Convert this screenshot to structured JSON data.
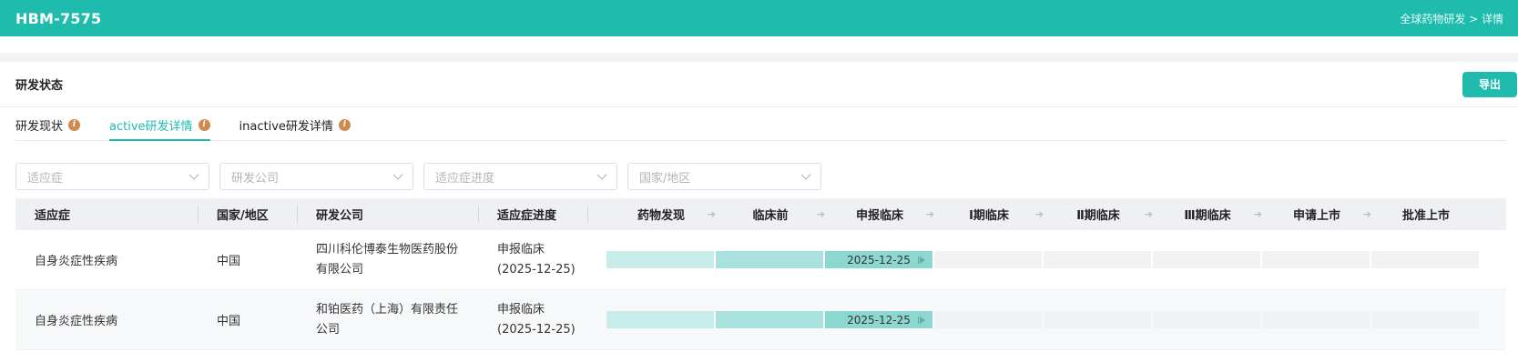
{
  "header": {
    "title": "HBM-7575",
    "breadcrumb": "全球药物研发 > 详情"
  },
  "card": {
    "title": "研发状态",
    "export_label": "导出"
  },
  "tabs": [
    {
      "label": "研发现状"
    },
    {
      "label": "active研发详情"
    },
    {
      "label": "inactive研发详情"
    }
  ],
  "filters": {
    "indication": "适应症",
    "company": "研发公司",
    "progress": "适应症进度",
    "region": "国家/地区"
  },
  "table": {
    "headers": {
      "indication": "适应症",
      "region": "国家/地区",
      "company": "研发公司",
      "progress": "适应症进度"
    },
    "stages": [
      "药物发现",
      "临床前",
      "申报临床",
      "Ⅰ期临床",
      "Ⅱ期临床",
      "Ⅲ期临床",
      "申请上市",
      "批准上市"
    ],
    "rows": [
      {
        "indication": "自身炎症性疾病",
        "region": "中国",
        "company_line1": "四川科伦博泰生物医药股份",
        "company_line2": "有限公司",
        "progress_line1": "申报临床",
        "progress_line2": "(2025-12-25)",
        "stage_date": "2025-12-25"
      },
      {
        "indication": "自身炎症性疾病",
        "region": "中国",
        "company_line1": "和铂医药（上海）有限责任",
        "company_line2": "公司",
        "progress_line1": "申报临床",
        "progress_line2": "(2025-12-25)",
        "stage_date": "2025-12-25"
      }
    ]
  },
  "colors": {
    "brand": "#1fbcae",
    "info_icon": "#d08a4f"
  }
}
